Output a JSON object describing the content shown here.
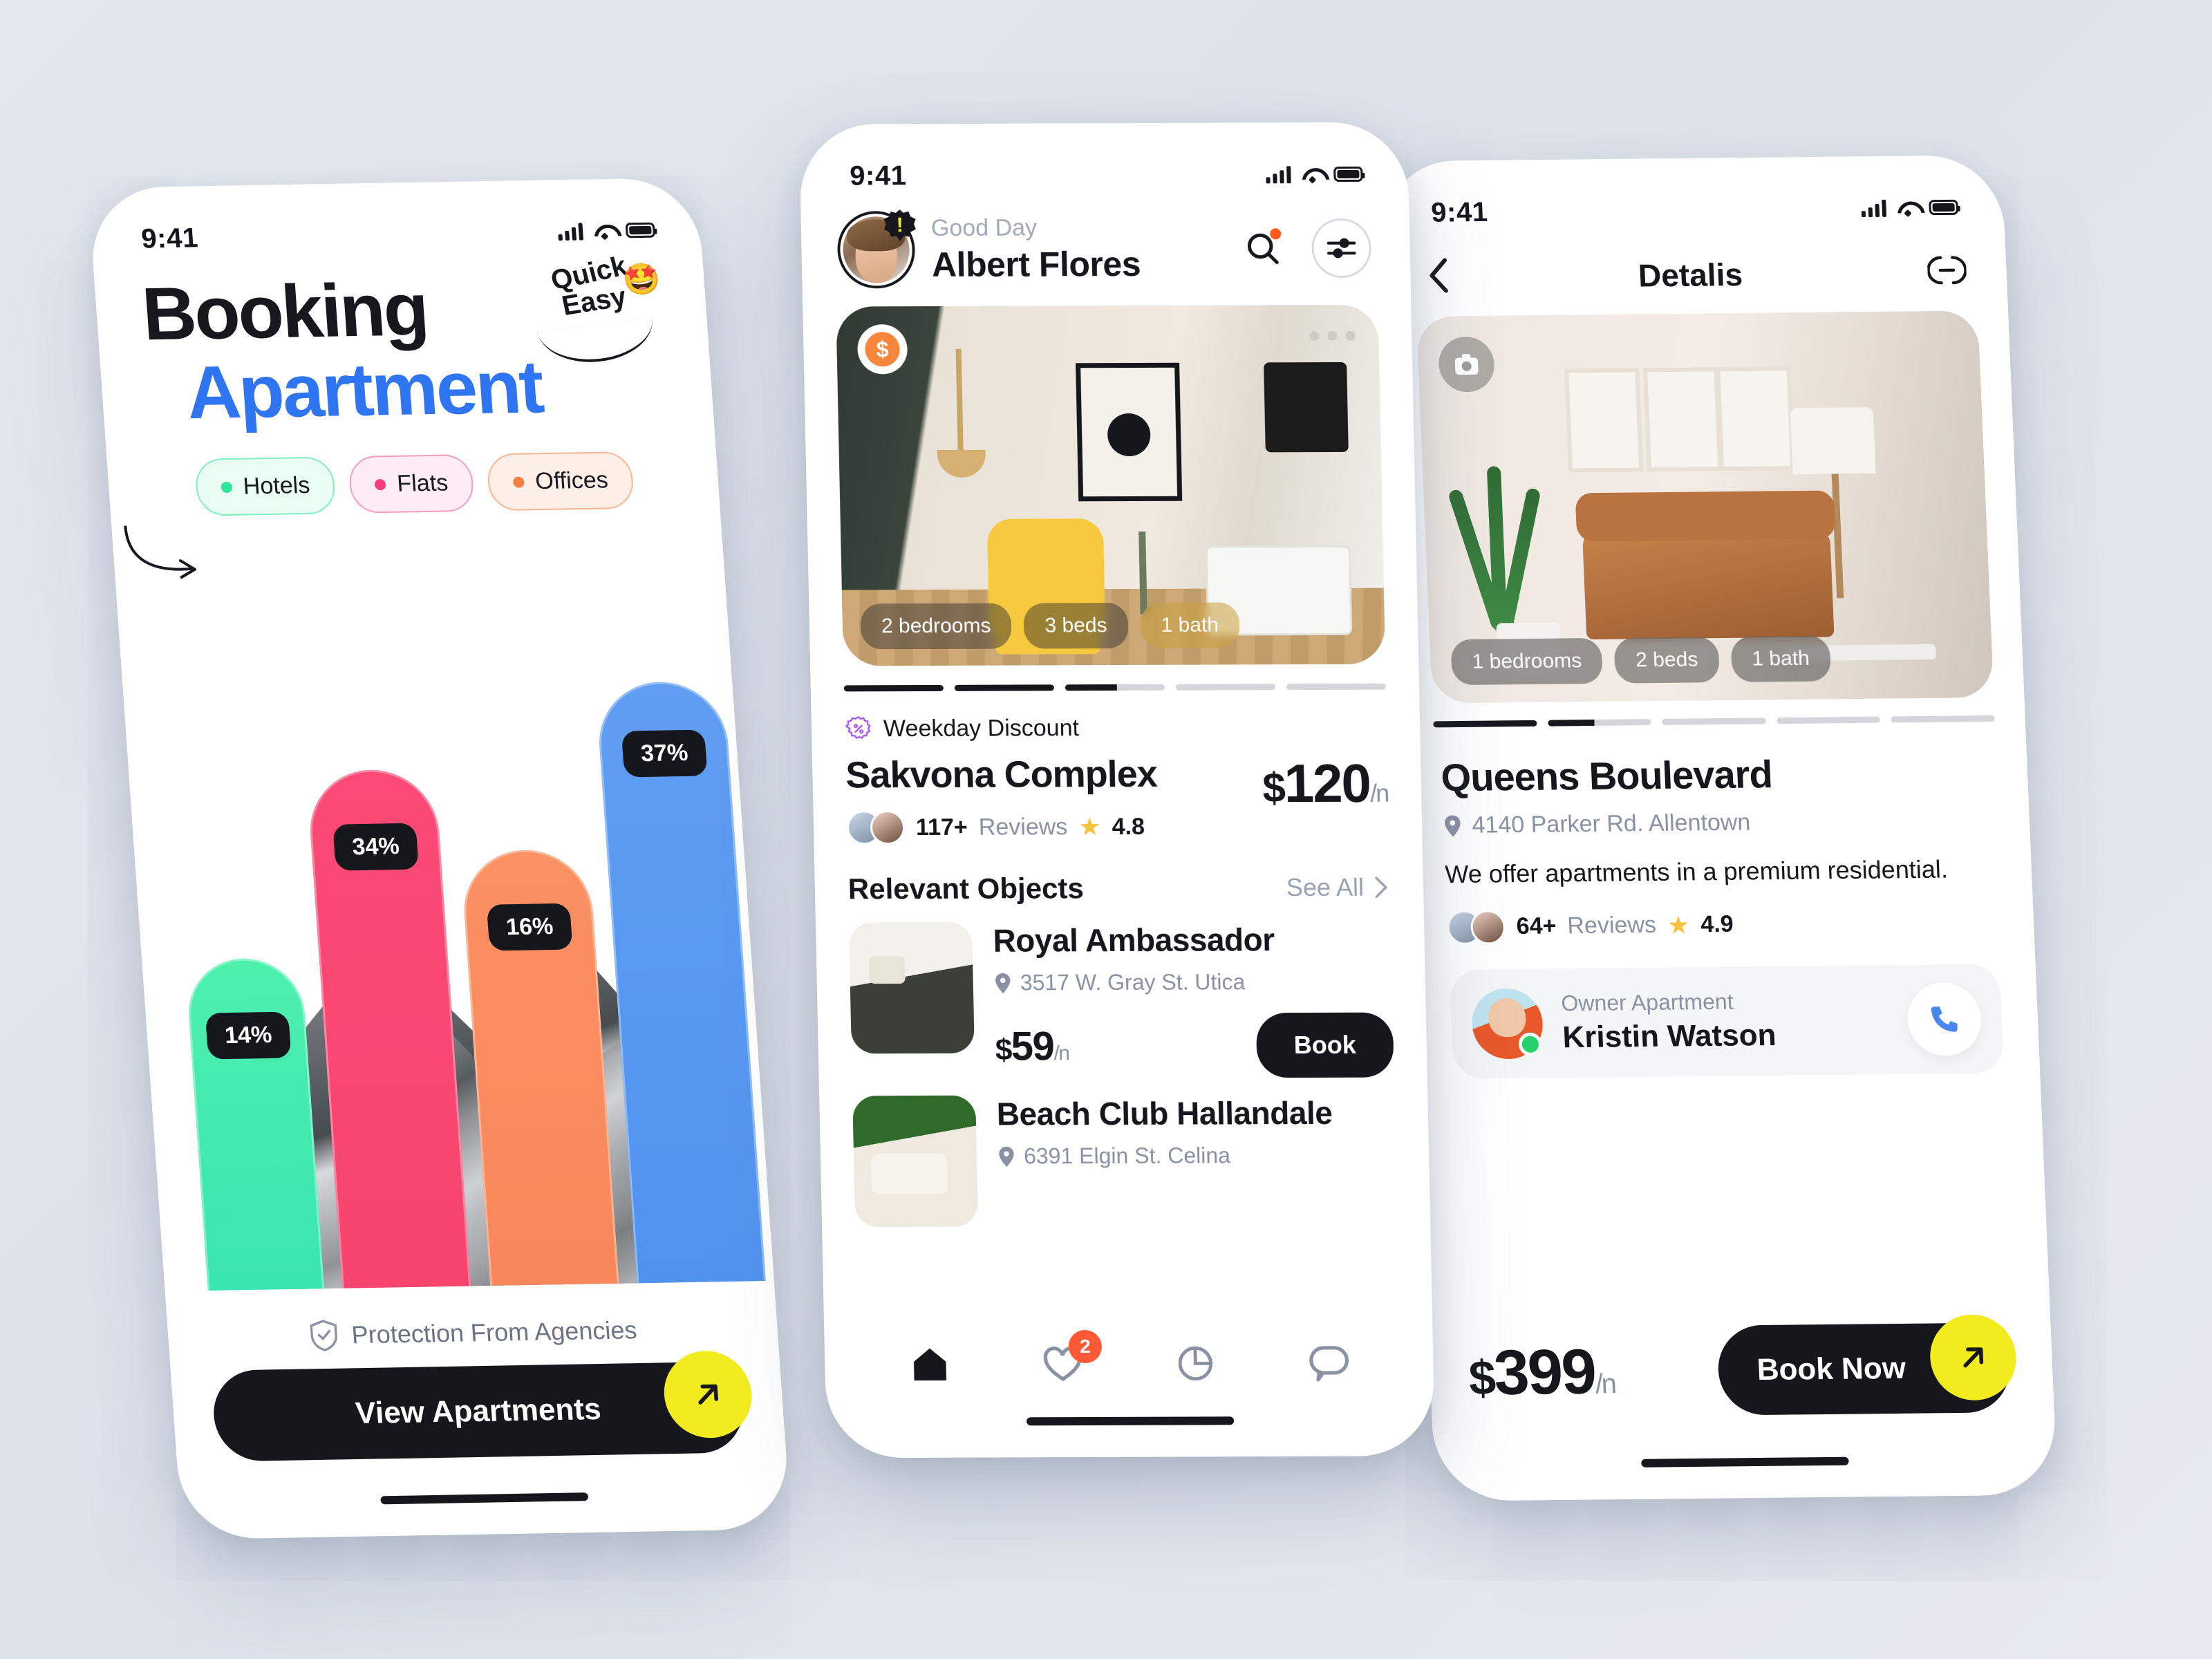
{
  "status_bar": {
    "time": "9:41"
  },
  "phone1": {
    "title_line1": "Booking",
    "title_line2": "Apartment",
    "badge_line1": "Quick",
    "badge_line2": "Easy",
    "badge_emoji": "🤩",
    "pills": [
      {
        "label": "Hotels",
        "dot_color": "#2ce69b"
      },
      {
        "label": "Flats",
        "dot_color": "#f63e7f"
      },
      {
        "label": "Offices",
        "dot_color": "#f77f46"
      }
    ],
    "protection_text": "Protection From Agencies",
    "cta_label": "View Apartments",
    "chart_data": {
      "type": "bar",
      "title": "",
      "categories": [
        "14%",
        "34%",
        "16%",
        "37%"
      ],
      "values": [
        14,
        34,
        16,
        37
      ],
      "labels": [
        "14%",
        "34%",
        "16%",
        "37%"
      ],
      "colors": [
        "#3fe8b0",
        "#f8456f",
        "#f9895b",
        "#5396f0"
      ],
      "xlabel": "",
      "ylabel": "",
      "ylim": [
        0,
        40
      ],
      "grid": false,
      "legend": "none"
    }
  },
  "phone2": {
    "greeting": "Good Day",
    "user_name": "Albert Flores",
    "hero_tags": [
      "2 bedrooms",
      "3 beds",
      "1 bath"
    ],
    "discount_label": "Weekday Discount",
    "listing_name": "Sakvona Complex",
    "reviews_count": "117+",
    "reviews_word": "Reviews",
    "rating": "4.8",
    "price_currency": "$",
    "price_value": "120",
    "price_period": "/n",
    "section_title": "Relevant Objects",
    "see_all": "See All",
    "objects": [
      {
        "name": "Royal Ambassador",
        "address": "3517 W. Gray St. Utica",
        "price_currency": "$",
        "price_value": "59",
        "price_period": "/n",
        "book_label": "Book"
      },
      {
        "name": "Beach Club Hallandale",
        "address": "6391 Elgin St. Celina"
      }
    ],
    "tabs": [
      {
        "name": "home",
        "badge": ""
      },
      {
        "name": "favorites",
        "badge": "2"
      },
      {
        "name": "stats",
        "badge": ""
      },
      {
        "name": "chat",
        "badge": ""
      }
    ]
  },
  "phone3": {
    "nav_title": "Detalis",
    "hero_tags": [
      "1 bedrooms",
      "2 beds",
      "1 bath"
    ],
    "listing_name": "Queens Boulevard",
    "address": "4140 Parker Rd. Allentown",
    "description": "We offer apartments in a premium residential.",
    "reviews_count": "64+",
    "reviews_word": "Reviews",
    "rating": "4.9",
    "owner_role": "Owner Apartment",
    "owner_name": "Kristin Watson",
    "price_currency": "$",
    "price_value": "399",
    "price_period": "/n",
    "book_label": "Book Now"
  }
}
